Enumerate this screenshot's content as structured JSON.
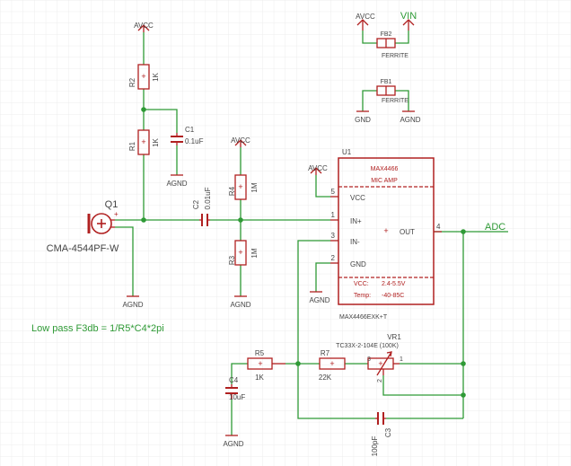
{
  "colors": {
    "background": "#ffffff",
    "grid": "#e6e6e6",
    "wire": "#2f9a36",
    "junction": "#2f9a36",
    "symbol": "#b02020",
    "text": "#444444",
    "refdes": "#555555",
    "note": "#2f9a36"
  },
  "title_note": "Low pass F3db = 1/R5*C4*2pi",
  "net_labels": {
    "adc": "ADC"
  },
  "power": {
    "avcc": "AVCC",
    "vin": "VIN",
    "agnd": "AGND",
    "gnd": "GND"
  },
  "components": {
    "r1": {
      "name": "R1",
      "value": "1K"
    },
    "r2": {
      "name": "R2",
      "value": "1K"
    },
    "r3": {
      "name": "R3",
      "value": "1M"
    },
    "r4": {
      "name": "R4",
      "value": "1M"
    },
    "r5": {
      "name": "R5",
      "value": "1K"
    },
    "r7": {
      "name": "R7",
      "value": "22K"
    },
    "c1": {
      "name": "C1",
      "value": "0.1uF"
    },
    "c2": {
      "name": "C2",
      "value": "0.01uF"
    },
    "c3": {
      "name": "C3",
      "value": "100pF"
    },
    "c4": {
      "name": "C4",
      "value": "10uF"
    },
    "q1": {
      "name": "Q1",
      "value": "CMA-4544PF-W"
    },
    "fb1": {
      "name": "FB1",
      "value": "FERRITE"
    },
    "fb2": {
      "name": "FB2",
      "value": "FERRITE"
    },
    "vr1": {
      "name": "VR1",
      "value": "TC33X-2-104E (100K)",
      "pin1": "1",
      "pin2": "2",
      "pin3": "3"
    },
    "u1": {
      "name": "U1",
      "title": "MAX4466",
      "subtitle": "MIC AMP",
      "part": "MAX4466EXK+T",
      "vcc_spec_label": "VCC:",
      "vcc_spec_value": "2.4-5.5V",
      "temp_spec_label": "Temp:",
      "temp_spec_value": "-40-85C",
      "pins": [
        {
          "num": "5",
          "name": "VCC"
        },
        {
          "num": "1",
          "name": "IN+"
        },
        {
          "num": "3",
          "name": "IN-"
        },
        {
          "num": "2",
          "name": "GND"
        },
        {
          "num": "4",
          "name": "OUT"
        }
      ]
    }
  }
}
